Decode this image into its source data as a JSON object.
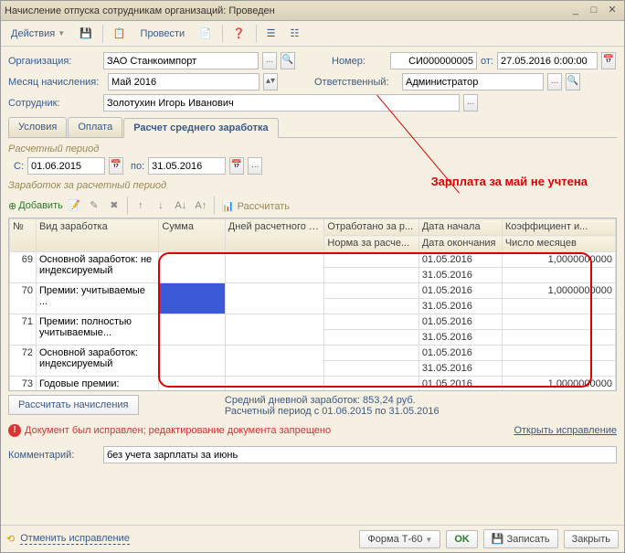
{
  "window": {
    "title": "Начисление отпуска сотрудникам организаций: Проведен"
  },
  "toolbar": {
    "actions": "Действия",
    "process": "Провести"
  },
  "form": {
    "org_label": "Организация:",
    "org_value": "ЗАО Станкоимпорт",
    "number_label": "Номер:",
    "number_value": "СИ000000005",
    "from_label": "от:",
    "date_value": "27.05.2016 0:00:00",
    "month_label": "Месяц начисления:",
    "month_value": "Май 2016",
    "resp_label": "Ответственный:",
    "resp_value": "Администратор",
    "emp_label": "Сотрудник:",
    "emp_value": "Золотухин Игорь Иванович"
  },
  "tabs": [
    "Условия",
    "Оплата",
    "Расчет среднего заработка"
  ],
  "period": {
    "group": "Расчетный период",
    "from_label": "С:",
    "from": "01.06.2015",
    "to_label": "по:",
    "to": "31.05.2016"
  },
  "earnings_group": "Заработок за расчетный период",
  "add_label": "Добавить",
  "recalc_label": "Рассчитать",
  "cols": {
    "num": "№",
    "type": "Вид заработка",
    "sum": "Сумма",
    "days": "Дней расчетного периода",
    "worked": "Отработано за р...",
    "norm": "Норма за расче...",
    "start": "Дата начала",
    "end": "Дата окончания",
    "coef": "Коэффициент и...",
    "months": "Число месяцев"
  },
  "rows": [
    {
      "n": "69",
      "type": "Основной заработок: не индексируемый",
      "start": "01.05.2016",
      "end": "31.05.2016",
      "coef": "1,0000000000"
    },
    {
      "n": "70",
      "type": "Премии: учитываемые ...",
      "start": "01.05.2016",
      "end": "31.05.2016",
      "coef": "1,0000000000"
    },
    {
      "n": "71",
      "type": "Премии: полностью учитываемые...",
      "start": "01.05.2016",
      "end": "31.05.2016",
      "coef": ""
    },
    {
      "n": "72",
      "type": "Основной заработок: индексируемый",
      "start": "01.05.2016",
      "end": "31.05.2016",
      "coef": ""
    },
    {
      "n": "73",
      "type": "Годовые премии: полностью",
      "start": "01.05.2016",
      "end": "",
      "coef": "1,0000000000"
    }
  ],
  "calc_accruals": "Рассчитать начисления",
  "avg1": "Средний дневной заработок: 853,24 руб.",
  "avg2": "Расчетный период с 01.06.2015 по 31.05.2016",
  "annotation": "Зарплата за май не учтена",
  "warning": "Документ был исправлен; редактирование документа запрещено",
  "open_correction": "Открыть исправление",
  "comment_label": "Комментарий:",
  "comment_value": "без учета зарплаты за июнь",
  "footer": {
    "undo": "Отменить исправление",
    "form_t60": "Форма Т-60",
    "ok": "OK",
    "save": "Записать",
    "close": "Закрыть"
  }
}
